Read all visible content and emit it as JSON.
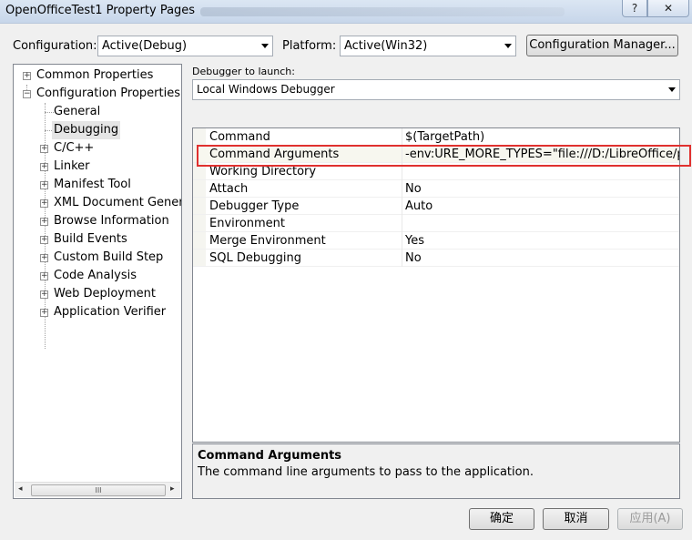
{
  "window": {
    "title": "OpenOfficeTest1 Property Pages",
    "help_label": "?",
    "close_label": "✕"
  },
  "config": {
    "configuration_label": "Configuration:",
    "configuration_value": "Active(Debug)",
    "platform_label": "Platform:",
    "platform_value": "Active(Win32)",
    "manager_button": "Configuration Manager..."
  },
  "tree": {
    "items": [
      {
        "label": "Common Properties",
        "expander": "+"
      },
      {
        "label": "Configuration Properties",
        "expander": "−"
      },
      {
        "label": "General"
      },
      {
        "label": "Debugging"
      },
      {
        "label": "C/C++",
        "expander": "+"
      },
      {
        "label": "Linker",
        "expander": "+"
      },
      {
        "label": "Manifest Tool",
        "expander": "+"
      },
      {
        "label": "XML Document Generat",
        "expander": "+"
      },
      {
        "label": "Browse Information",
        "expander": "+"
      },
      {
        "label": "Build Events",
        "expander": "+"
      },
      {
        "label": "Custom Build Step",
        "expander": "+"
      },
      {
        "label": "Code Analysis",
        "expander": "+"
      },
      {
        "label": "Web Deployment",
        "expander": "+"
      },
      {
        "label": "Application Verifier",
        "expander": "+"
      }
    ],
    "scroll_left": "◂",
    "scroll_right": "▸",
    "scroll_thumb": "III"
  },
  "debugger": {
    "label": "Debugger to launch:",
    "value": "Local Windows Debugger"
  },
  "properties": [
    {
      "name": "Command",
      "value": "$(TargetPath)"
    },
    {
      "name": "Command Arguments",
      "value": "-env:URE_MORE_TYPES=\"file:///D:/LibreOffice/progr"
    },
    {
      "name": "Working Directory",
      "value": ""
    },
    {
      "name": "Attach",
      "value": "No"
    },
    {
      "name": "Debugger Type",
      "value": "Auto"
    },
    {
      "name": "Environment",
      "value": ""
    },
    {
      "name": "Merge Environment",
      "value": "Yes"
    },
    {
      "name": "SQL Debugging",
      "value": "No"
    }
  ],
  "description": {
    "title": "Command Arguments",
    "text": "The command line arguments to pass to the application."
  },
  "buttons": {
    "ok": "确定",
    "cancel": "取消",
    "apply": "应用(A)"
  },
  "colors": {
    "highlight_border": "#e0312f",
    "selection_bg": "#e5e5e5"
  }
}
